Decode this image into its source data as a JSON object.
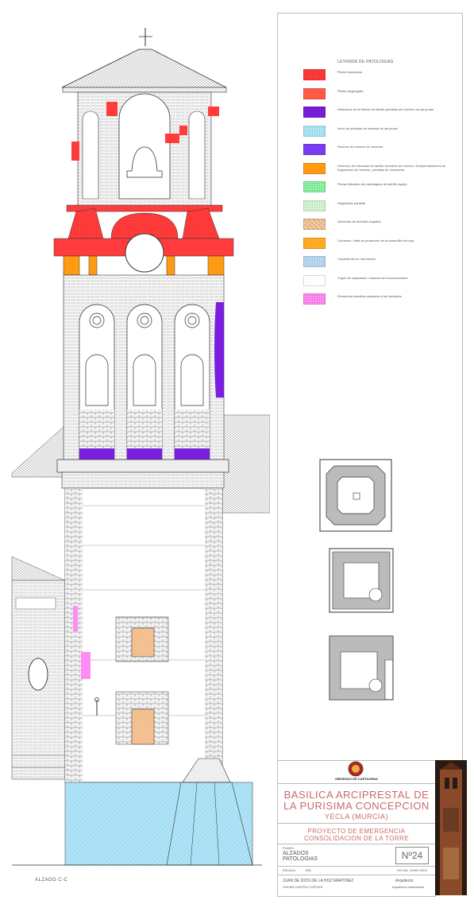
{
  "legend": {
    "title": "LEYENDA DE PATOLOGIAS",
    "items": [
      {
        "color": "#ff3b3b",
        "pattern": "dots",
        "text": "Piedra fracturada"
      },
      {
        "color": "#ff5a46",
        "pattern": "solid",
        "text": "Piedra disgregada"
      },
      {
        "color": "#7b1ee0",
        "pattern": "dots",
        "text": "Deterioros de la fábrica de ladrillo pérdidas del mortero de las juntas"
      },
      {
        "color": "#aee8f6",
        "pattern": "dots",
        "text": "Inicio de pérdidas de material de las juntas"
      },
      {
        "color": "#7a3cf0",
        "pattern": "solid",
        "text": "Parches de mortero de cemento"
      },
      {
        "color": "#ff9a12",
        "pattern": "solid",
        "text": "Deterioro de ménsulas de ladrillo revestido de mortero. Desprendimientos de fragmentos del mortero, pérdidas de volumetría"
      },
      {
        "color": "#8ff2a2",
        "pattern": "dots",
        "text": "Piezas faltantes del vierteaguas de ladrillo espejo"
      },
      {
        "color": "#d6f7d6",
        "pattern": "dots",
        "text": "Vegetación parásita"
      },
      {
        "color": "#f8c99d",
        "pattern": "hatch",
        "text": "Aberturas de fachada cegadas"
      },
      {
        "color": "#ffaa22",
        "pattern": "solid",
        "text": "Corrosión / falta de protección de la barandilla de forja"
      },
      {
        "color": "#b9daf6",
        "pattern": "dots",
        "text": "Carpinterías en mal estado"
      },
      {
        "color": "#ffffff",
        "pattern": "solid",
        "text": "Yugos de campanas / motores sin funcionamiento"
      },
      {
        "color": "#ff8cf2",
        "pattern": "dots",
        "text": "Elementos extraños adosados a las fachadas"
      }
    ]
  },
  "title_block": {
    "diocese": "OBISPADO DE CARTAGENA",
    "church_line1": "BASILICA ARCIPRESTAL DE",
    "church_line2": "LA PURISIMA CONCEPCION",
    "town": "YECLA (MURCIA)",
    "project_line1": "PROYECTO DE EMERGENCIA",
    "project_line2": "CONSOLIDACION DE LA TORRE",
    "plano_label": "PLANO:",
    "plano_line1": "ALZADOS",
    "plano_line2": "PATOLOGIAS",
    "sheet_number": "Nº24",
    "scale_label": "ESCALA:",
    "scale_value": "1/50",
    "date_label": "FECHA: JUNIO 2003",
    "architect1": "JUAN DE DIOS DE LA HOZ MARTINEZ",
    "architect2": "OSCAR CASTRO CORCES",
    "role1": "Arquitecto",
    "role2": "Arquitecto colaborador"
  },
  "view_label": "ALZADO C-C"
}
